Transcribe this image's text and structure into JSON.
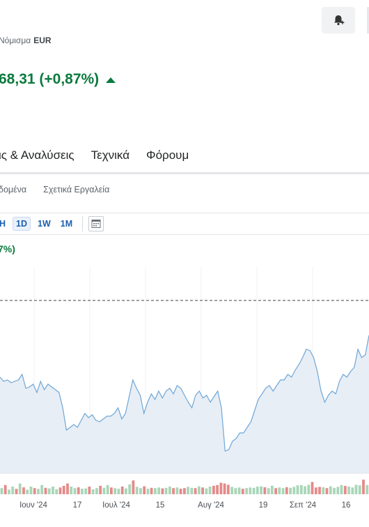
{
  "header": {
    "currency_label": "Νόμισμα",
    "currency_value": "EUR",
    "price_change": "68,31 (+0,87%)",
    "alert_button_icon": "bell-plus-icon"
  },
  "main_tabs": [
    "ις & Αναλύσεις",
    "Τεχνικά",
    "Φόρουμ"
  ],
  "sub_tabs": [
    "δομένα",
    "Σχετικά Εργαλεία"
  ],
  "toolbar": {
    "timeframes": [
      "H",
      "1D",
      "1W",
      "1M"
    ],
    "selected": "1D",
    "calendar_icon": "calendar-icon"
  },
  "chart_pct": "7%)",
  "colors": {
    "up": "#0a7a3e",
    "line": "#6ea6d6",
    "area": "#e7eef6",
    "vol_up": "#a9d6b8",
    "vol_down": "#e58a8a",
    "link": "#1b5fad"
  },
  "chart_data": {
    "type": "area",
    "x_ticks": [
      "Ιουν '24",
      "17",
      "Ιουλ '24",
      "15",
      "Αυγ '24",
      "19",
      "Σεπ '24",
      "16"
    ],
    "price_series_relative": [
      0.58,
      0.55,
      0.56,
      0.54,
      0.55,
      0.56,
      0.6,
      0.5,
      0.51,
      0.53,
      0.47,
      0.55,
      0.49,
      0.53,
      0.51,
      0.49,
      0.47,
      0.36,
      0.2,
      0.22,
      0.24,
      0.22,
      0.27,
      0.32,
      0.29,
      0.31,
      0.27,
      0.26,
      0.28,
      0.3,
      0.3,
      0.32,
      0.36,
      0.28,
      0.32,
      0.44,
      0.56,
      0.5,
      0.45,
      0.32,
      0.4,
      0.46,
      0.42,
      0.48,
      0.43,
      0.48,
      0.5,
      0.46,
      0.52,
      0.5,
      0.45,
      0.4,
      0.36,
      0.45,
      0.48,
      0.43,
      0.45,
      0.4,
      0.44,
      0.48,
      0.36,
      0.05,
      0.06,
      0.12,
      0.14,
      0.18,
      0.18,
      0.22,
      0.26,
      0.34,
      0.42,
      0.46,
      0.5,
      0.52,
      0.48,
      0.52,
      0.56,
      0.56,
      0.6,
      0.58,
      0.63,
      0.67,
      0.72,
      0.78,
      0.77,
      0.72,
      0.62,
      0.48,
      0.4,
      0.45,
      0.48,
      0.46,
      0.55,
      0.6,
      0.58,
      0.62,
      0.65,
      0.78,
      0.72,
      0.74,
      0.88
    ],
    "volume_relative": [
      0.4,
      0.6,
      0.3,
      0.5,
      0.35,
      0.7,
      0.45,
      0.3,
      0.5,
      0.4,
      0.35,
      0.6,
      0.42,
      0.38,
      0.5,
      0.33,
      0.44,
      0.55,
      0.7,
      0.5,
      0.4,
      0.45,
      0.36,
      0.38,
      0.5,
      0.32,
      0.4,
      0.55,
      0.42,
      0.6,
      0.44,
      0.4,
      0.36,
      0.5,
      0.38,
      0.64,
      0.9,
      0.48,
      0.4,
      0.52,
      0.36,
      0.42,
      0.4,
      0.44,
      0.38,
      0.42,
      0.5,
      0.4,
      0.44,
      0.36,
      0.4,
      0.48,
      0.42,
      0.4,
      0.52,
      0.44,
      0.38,
      0.5,
      0.55,
      0.6,
      0.75,
      0.7,
      0.62,
      0.48,
      0.4,
      0.44,
      0.36,
      0.4,
      0.44,
      0.42,
      0.5,
      0.52,
      0.46,
      0.4,
      0.56,
      0.4,
      0.44,
      0.4,
      0.46,
      0.42,
      0.48,
      0.58,
      0.6,
      0.52,
      0.62,
      0.8,
      0.44,
      0.48,
      0.46,
      0.4,
      0.52,
      0.42,
      0.48,
      0.6,
      0.54,
      0.5,
      0.44,
      0.62,
      0.58,
      0.95,
      0.6
    ],
    "volume_direction": [
      1,
      0,
      1,
      1,
      0,
      1,
      0,
      1,
      1,
      0,
      1,
      1,
      0,
      1,
      1,
      1,
      0,
      0,
      0,
      1,
      1,
      0,
      1,
      1,
      0,
      1,
      1,
      0,
      1,
      1,
      0,
      1,
      1,
      0,
      1,
      1,
      0,
      1,
      1,
      0,
      1,
      0,
      1,
      1,
      0,
      1,
      1,
      0,
      1,
      0,
      0,
      1,
      1,
      0,
      1,
      0,
      1,
      1,
      0,
      0,
      0,
      0,
      0,
      1,
      1,
      1,
      0,
      1,
      1,
      1,
      1,
      1,
      0,
      1,
      1,
      0,
      1,
      1,
      0,
      1,
      1,
      1,
      1,
      1,
      1,
      0,
      0,
      0,
      1,
      0,
      1,
      1,
      1,
      1,
      0,
      1,
      1,
      1,
      1,
      0,
      1
    ],
    "grid": true
  }
}
